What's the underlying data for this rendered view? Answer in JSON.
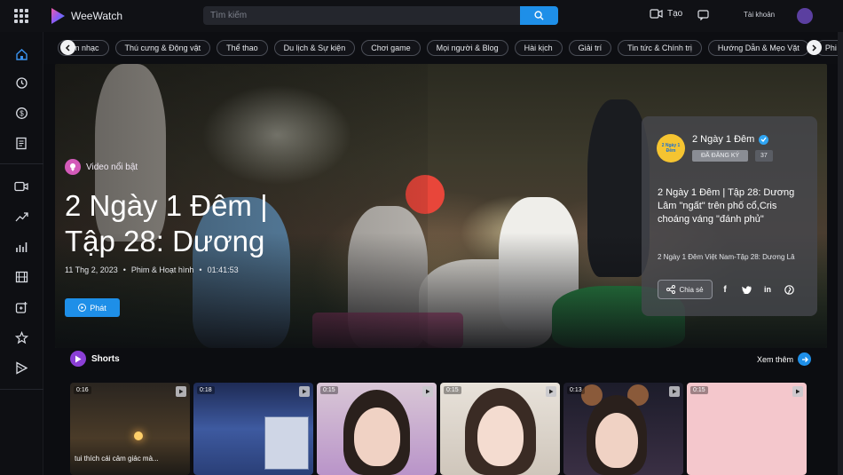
{
  "app": {
    "name": "WeeWatch"
  },
  "search": {
    "placeholder": "Tìm kiếm"
  },
  "header": {
    "create_label": "Tạo",
    "right_text": "Tài khoản"
  },
  "categories": [
    "Âm nhạc",
    "Thú cưng & Động vật",
    "Thể thao",
    "Du lịch & Sự kiện",
    "Chơi game",
    "Mọi người & Blog",
    "Hài kịch",
    "Giải trí",
    "Tin tức & Chính trị",
    "Hướng Dẫn & Mẹo Vặt",
    "Phi lợi nhuận"
  ],
  "sidebar_icons": [
    "home-icon",
    "history-icon",
    "dollar-icon",
    "document-icon",
    "video-camera-icon",
    "trending-icon",
    "chart-icon",
    "film-icon",
    "add-video-icon",
    "star-icon",
    "play-logo-icon"
  ],
  "hero": {
    "badge": "Video nổi bật",
    "title": "2 Ngày 1 Đêm | Tập 28: Dương",
    "date": "11 Thg 2, 2023",
    "category": "Phim & Hoạt hình",
    "duration": "01:41:53",
    "play_label": "Phát"
  },
  "channel_card": {
    "channel_name": "2 Ngày 1 Đêm",
    "avatar_text": "2 Ngày 1 Đêm",
    "subscribed_label": "ĐÃ ĐĂNG KÝ",
    "subscriber_count": "37",
    "title": "2 Ngày 1 Đêm | Tập 28: Dương Lâm \"ngất\" trên phố cổ,Cris choáng váng \"đánh phủ\"",
    "description": "2 Ngày 1 Đêm Việt Nam-Tập 28: Dương Lâ",
    "share_label": "Chia sẻ",
    "social": [
      "facebook-icon",
      "twitter-icon",
      "linkedin-icon",
      "pinterest-icon"
    ]
  },
  "shorts": {
    "heading": "Shorts",
    "see_more": "Xem thêm",
    "items": [
      {
        "duration": "0:16",
        "caption": "tui thích cái cảm giác mà..."
      },
      {
        "duration": "0:18",
        "caption": ""
      },
      {
        "duration": "0:15",
        "caption": ""
      },
      {
        "duration": "0:15",
        "caption": ""
      },
      {
        "duration": "0:13",
        "caption": ""
      },
      {
        "duration": "0:15",
        "caption": ""
      }
    ]
  },
  "colors": {
    "accent": "#1e8fe8",
    "background": "#0c0d11",
    "featured_badge": "#d35ab9",
    "shorts_badge": "#8b3fd6"
  }
}
